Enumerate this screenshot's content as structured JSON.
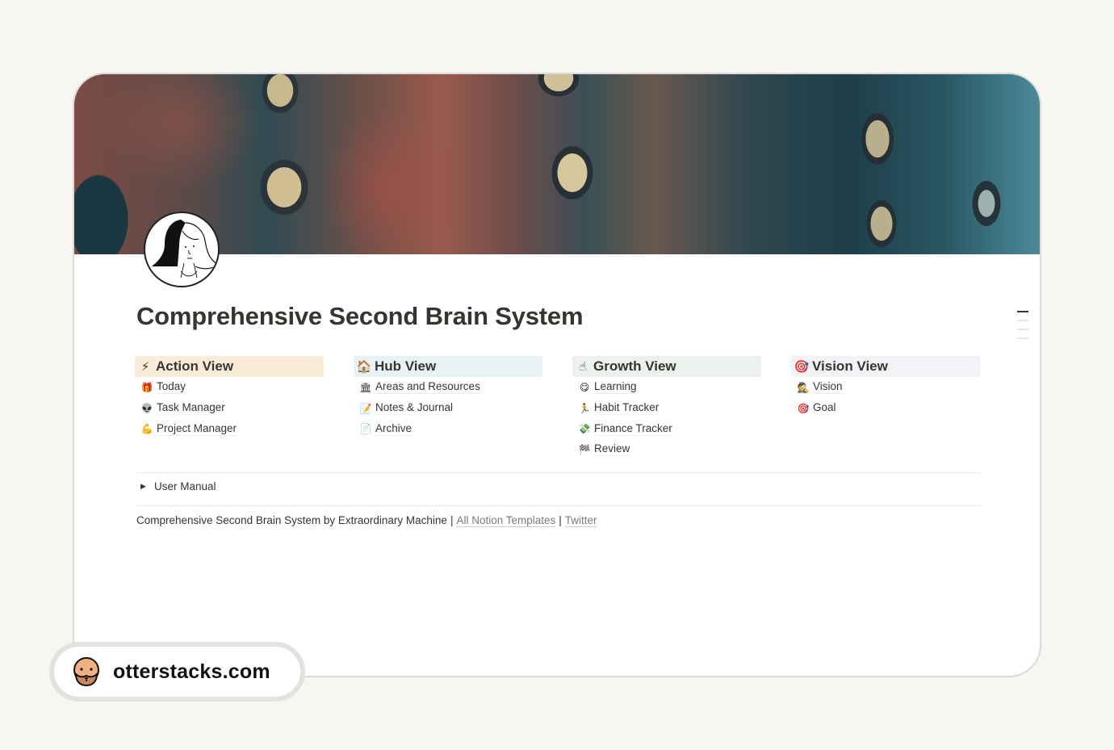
{
  "page": {
    "title": "Comprehensive Second Brain System"
  },
  "columns": [
    {
      "title": "Action View",
      "icon": "⚡",
      "icon_name": "lightning-icon",
      "color": "#fbecd8",
      "items": [
        {
          "label": "Today",
          "icon": "🎁",
          "icon_name": "gift-icon"
        },
        {
          "label": "Task Manager",
          "icon": "👽",
          "icon_name": "alien-icon"
        },
        {
          "label": "Project Manager",
          "icon": "💪",
          "icon_name": "flexed-arm-icon"
        }
      ]
    },
    {
      "title": "Hub View",
      "icon": "🏠",
      "icon_name": "house-icon",
      "color": "#e8f2f5",
      "items": [
        {
          "label": "Areas and Resources",
          "icon": "🏛",
          "icon_name": "classical-building-icon"
        },
        {
          "label": "Notes & Journal",
          "icon": "📝",
          "icon_name": "memo-icon"
        },
        {
          "label": "Archive",
          "icon": "📄",
          "icon_name": "page-icon"
        }
      ]
    },
    {
      "title": "Growth View",
      "icon": "☝",
      "icon_name": "pointing-up-icon",
      "color": "#edf1ed",
      "items": [
        {
          "label": "Learning",
          "icon": "😋",
          "icon_name": "smiling-face-icon"
        },
        {
          "label": "Habit Tracker",
          "icon": "🏃",
          "icon_name": "runner-icon"
        },
        {
          "label": "Finance Tracker",
          "icon": "💸",
          "icon_name": "money-wings-icon"
        },
        {
          "label": "Review",
          "icon": "🏁",
          "icon_name": "checkered-flag-icon"
        }
      ]
    },
    {
      "title": "Vision View",
      "icon": "🎯",
      "icon_name": "target-icon",
      "color": "#f3f2f6",
      "items": [
        {
          "label": "Vision",
          "icon": "🕵",
          "icon_name": "detective-icon"
        },
        {
          "label": "Goal",
          "icon": "🎯",
          "icon_name": "target-icon"
        }
      ]
    }
  ],
  "toggle": {
    "label": "User Manual",
    "arrow": "▶"
  },
  "footer": {
    "text": "Comprehensive Second Brain System by Extraordinary Machine",
    "separator": "|",
    "links": [
      "All Notion Templates",
      "Twitter"
    ]
  },
  "badge": {
    "domain": "otterstacks.com"
  }
}
